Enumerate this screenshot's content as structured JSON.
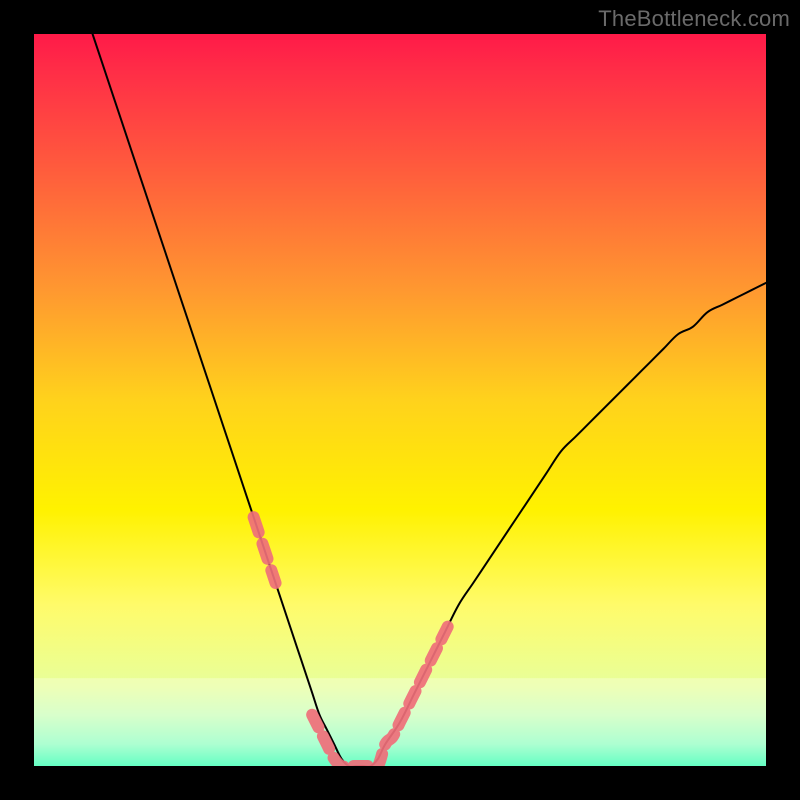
{
  "watermark": "TheBottleneck.com",
  "chart_data": {
    "type": "line",
    "title": "",
    "xlabel": "",
    "ylabel": "",
    "xlim": [
      0,
      100
    ],
    "ylim": [
      0,
      100
    ],
    "grid": false,
    "legend": false,
    "x": [
      8,
      10,
      12,
      14,
      16,
      18,
      20,
      22,
      24,
      26,
      28,
      30,
      32,
      33,
      34,
      35,
      36,
      37,
      38,
      39,
      40,
      41,
      42,
      43,
      44,
      45,
      46,
      47,
      48,
      50,
      52,
      54,
      56,
      58,
      60,
      62,
      64,
      66,
      68,
      70,
      72,
      74,
      76,
      78,
      80,
      82,
      84,
      86,
      88,
      90,
      92,
      94,
      96,
      98,
      100
    ],
    "values": [
      100,
      94,
      88,
      82,
      76,
      70,
      64,
      58,
      52,
      46,
      40,
      34,
      28,
      25,
      22,
      19,
      16,
      13,
      10,
      7,
      5,
      3,
      1,
      0,
      0,
      0,
      0,
      1,
      3,
      6,
      10,
      14,
      18,
      22,
      25,
      28,
      31,
      34,
      37,
      40,
      43,
      45,
      47,
      49,
      51,
      53,
      55,
      57,
      59,
      60,
      62,
      63,
      64,
      65,
      66
    ],
    "highlight_band_y": [
      0,
      12
    ],
    "highlight_points_x": [
      30,
      31,
      32,
      33,
      38,
      39,
      40,
      41,
      42,
      43,
      44,
      45,
      46,
      47,
      48,
      49,
      50,
      51,
      52,
      53,
      54,
      55,
      56,
      57
    ],
    "highlight_points_y": [
      34,
      31,
      28,
      25,
      7,
      5,
      3,
      1,
      0,
      0,
      0,
      0,
      0,
      0,
      3,
      4,
      6,
      8,
      10,
      12,
      14,
      16,
      18,
      20
    ],
    "gradient_stops": [
      {
        "offset": 0.0,
        "color": "#ff1a48"
      },
      {
        "offset": 0.05,
        "color": "#ff2d47"
      },
      {
        "offset": 0.18,
        "color": "#ff5a3d"
      },
      {
        "offset": 0.35,
        "color": "#ff9830"
      },
      {
        "offset": 0.5,
        "color": "#ffd21c"
      },
      {
        "offset": 0.65,
        "color": "#fff200"
      },
      {
        "offset": 0.78,
        "color": "#fffb6a"
      },
      {
        "offset": 0.89,
        "color": "#e8ff9a"
      },
      {
        "offset": 0.93,
        "color": "#caffb7"
      },
      {
        "offset": 0.97,
        "color": "#8effc0"
      },
      {
        "offset": 1.0,
        "color": "#2bffad"
      }
    ]
  }
}
